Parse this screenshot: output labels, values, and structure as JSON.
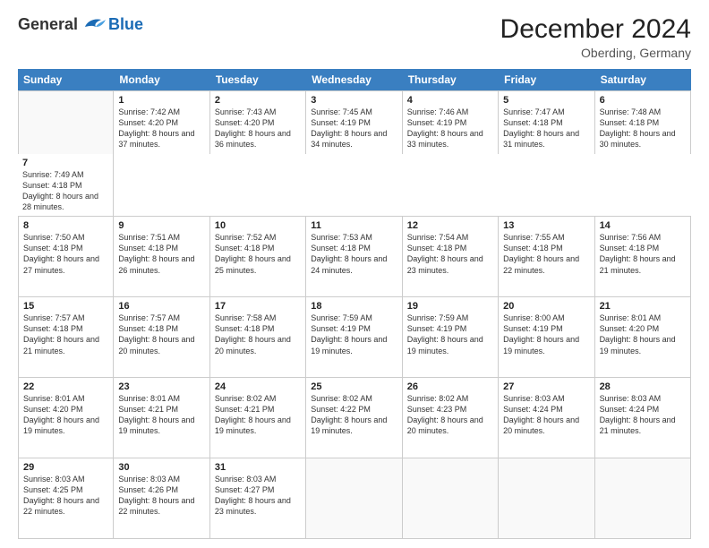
{
  "header": {
    "logo": {
      "general": "General",
      "blue": "Blue"
    },
    "title": "December 2024",
    "location": "Oberding, Germany"
  },
  "calendar": {
    "headers": [
      "Sunday",
      "Monday",
      "Tuesday",
      "Wednesday",
      "Thursday",
      "Friday",
      "Saturday"
    ],
    "rows": [
      [
        {
          "day": "",
          "sunrise": "",
          "sunset": "",
          "daylight": "",
          "empty": true
        },
        {
          "day": "1",
          "sunrise": "Sunrise: 7:42 AM",
          "sunset": "Sunset: 4:20 PM",
          "daylight": "Daylight: 8 hours and 37 minutes."
        },
        {
          "day": "2",
          "sunrise": "Sunrise: 7:43 AM",
          "sunset": "Sunset: 4:20 PM",
          "daylight": "Daylight: 8 hours and 36 minutes."
        },
        {
          "day": "3",
          "sunrise": "Sunrise: 7:45 AM",
          "sunset": "Sunset: 4:19 PM",
          "daylight": "Daylight: 8 hours and 34 minutes."
        },
        {
          "day": "4",
          "sunrise": "Sunrise: 7:46 AM",
          "sunset": "Sunset: 4:19 PM",
          "daylight": "Daylight: 8 hours and 33 minutes."
        },
        {
          "day": "5",
          "sunrise": "Sunrise: 7:47 AM",
          "sunset": "Sunset: 4:18 PM",
          "daylight": "Daylight: 8 hours and 31 minutes."
        },
        {
          "day": "6",
          "sunrise": "Sunrise: 7:48 AM",
          "sunset": "Sunset: 4:18 PM",
          "daylight": "Daylight: 8 hours and 30 minutes."
        },
        {
          "day": "7",
          "sunrise": "Sunrise: 7:49 AM",
          "sunset": "Sunset: 4:18 PM",
          "daylight": "Daylight: 8 hours and 28 minutes."
        }
      ],
      [
        {
          "day": "8",
          "sunrise": "Sunrise: 7:50 AM",
          "sunset": "Sunset: 4:18 PM",
          "daylight": "Daylight: 8 hours and 27 minutes."
        },
        {
          "day": "9",
          "sunrise": "Sunrise: 7:51 AM",
          "sunset": "Sunset: 4:18 PM",
          "daylight": "Daylight: 8 hours and 26 minutes."
        },
        {
          "day": "10",
          "sunrise": "Sunrise: 7:52 AM",
          "sunset": "Sunset: 4:18 PM",
          "daylight": "Daylight: 8 hours and 25 minutes."
        },
        {
          "day": "11",
          "sunrise": "Sunrise: 7:53 AM",
          "sunset": "Sunset: 4:18 PM",
          "daylight": "Daylight: 8 hours and 24 minutes."
        },
        {
          "day": "12",
          "sunrise": "Sunrise: 7:54 AM",
          "sunset": "Sunset: 4:18 PM",
          "daylight": "Daylight: 8 hours and 23 minutes."
        },
        {
          "day": "13",
          "sunrise": "Sunrise: 7:55 AM",
          "sunset": "Sunset: 4:18 PM",
          "daylight": "Daylight: 8 hours and 22 minutes."
        },
        {
          "day": "14",
          "sunrise": "Sunrise: 7:56 AM",
          "sunset": "Sunset: 4:18 PM",
          "daylight": "Daylight: 8 hours and 21 minutes."
        }
      ],
      [
        {
          "day": "15",
          "sunrise": "Sunrise: 7:57 AM",
          "sunset": "Sunset: 4:18 PM",
          "daylight": "Daylight: 8 hours and 21 minutes."
        },
        {
          "day": "16",
          "sunrise": "Sunrise: 7:57 AM",
          "sunset": "Sunset: 4:18 PM",
          "daylight": "Daylight: 8 hours and 20 minutes."
        },
        {
          "day": "17",
          "sunrise": "Sunrise: 7:58 AM",
          "sunset": "Sunset: 4:18 PM",
          "daylight": "Daylight: 8 hours and 20 minutes."
        },
        {
          "day": "18",
          "sunrise": "Sunrise: 7:59 AM",
          "sunset": "Sunset: 4:19 PM",
          "daylight": "Daylight: 8 hours and 19 minutes."
        },
        {
          "day": "19",
          "sunrise": "Sunrise: 7:59 AM",
          "sunset": "Sunset: 4:19 PM",
          "daylight": "Daylight: 8 hours and 19 minutes."
        },
        {
          "day": "20",
          "sunrise": "Sunrise: 8:00 AM",
          "sunset": "Sunset: 4:19 PM",
          "daylight": "Daylight: 8 hours and 19 minutes."
        },
        {
          "day": "21",
          "sunrise": "Sunrise: 8:01 AM",
          "sunset": "Sunset: 4:20 PM",
          "daylight": "Daylight: 8 hours and 19 minutes."
        }
      ],
      [
        {
          "day": "22",
          "sunrise": "Sunrise: 8:01 AM",
          "sunset": "Sunset: 4:20 PM",
          "daylight": "Daylight: 8 hours and 19 minutes."
        },
        {
          "day": "23",
          "sunrise": "Sunrise: 8:01 AM",
          "sunset": "Sunset: 4:21 PM",
          "daylight": "Daylight: 8 hours and 19 minutes."
        },
        {
          "day": "24",
          "sunrise": "Sunrise: 8:02 AM",
          "sunset": "Sunset: 4:21 PM",
          "daylight": "Daylight: 8 hours and 19 minutes."
        },
        {
          "day": "25",
          "sunrise": "Sunrise: 8:02 AM",
          "sunset": "Sunset: 4:22 PM",
          "daylight": "Daylight: 8 hours and 19 minutes."
        },
        {
          "day": "26",
          "sunrise": "Sunrise: 8:02 AM",
          "sunset": "Sunset: 4:23 PM",
          "daylight": "Daylight: 8 hours and 20 minutes."
        },
        {
          "day": "27",
          "sunrise": "Sunrise: 8:03 AM",
          "sunset": "Sunset: 4:24 PM",
          "daylight": "Daylight: 8 hours and 20 minutes."
        },
        {
          "day": "28",
          "sunrise": "Sunrise: 8:03 AM",
          "sunset": "Sunset: 4:24 PM",
          "daylight": "Daylight: 8 hours and 21 minutes."
        }
      ],
      [
        {
          "day": "29",
          "sunrise": "Sunrise: 8:03 AM",
          "sunset": "Sunset: 4:25 PM",
          "daylight": "Daylight: 8 hours and 22 minutes."
        },
        {
          "day": "30",
          "sunrise": "Sunrise: 8:03 AM",
          "sunset": "Sunset: 4:26 PM",
          "daylight": "Daylight: 8 hours and 22 minutes."
        },
        {
          "day": "31",
          "sunrise": "Sunrise: 8:03 AM",
          "sunset": "Sunset: 4:27 PM",
          "daylight": "Daylight: 8 hours and 23 minutes."
        },
        {
          "day": "",
          "sunrise": "",
          "sunset": "",
          "daylight": "",
          "empty": true
        },
        {
          "day": "",
          "sunrise": "",
          "sunset": "",
          "daylight": "",
          "empty": true
        },
        {
          "day": "",
          "sunrise": "",
          "sunset": "",
          "daylight": "",
          "empty": true
        },
        {
          "day": "",
          "sunrise": "",
          "sunset": "",
          "daylight": "",
          "empty": true
        }
      ]
    ]
  }
}
